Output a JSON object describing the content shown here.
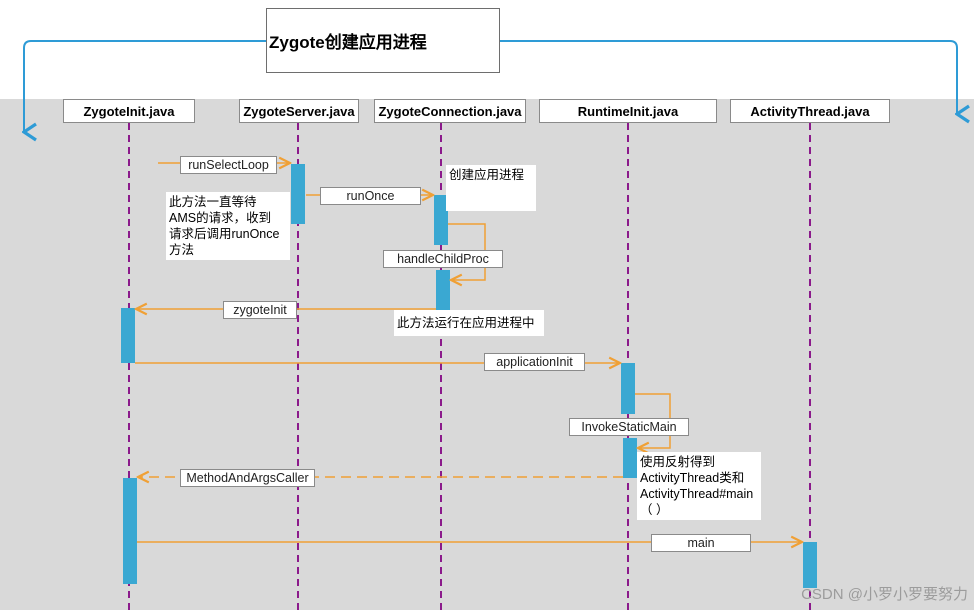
{
  "title": "Zygote创建应用进程",
  "lifelines": [
    {
      "id": "zygoteinit",
      "label": "ZygoteInit.java"
    },
    {
      "id": "zygoteserver",
      "label": "ZygoteServer.java"
    },
    {
      "id": "zygoteconnection",
      "label": "ZygoteConnection.java"
    },
    {
      "id": "runtimeinit",
      "label": "RuntimeInit.java"
    },
    {
      "id": "activitythread",
      "label": "ActivityThread.java"
    }
  ],
  "messages": [
    {
      "id": "runselectloop",
      "label": "runSelectLoop"
    },
    {
      "id": "runonce",
      "label": "runOnce"
    },
    {
      "id": "handlechildproc",
      "label": "handleChildProc"
    },
    {
      "id": "zygoteinit-call",
      "label": "zygoteInit"
    },
    {
      "id": "applicationinit",
      "label": "applicationInit"
    },
    {
      "id": "invokestaticmain",
      "label": "InvokeStaticMain"
    },
    {
      "id": "methodandargscaller",
      "label": "MethodAndArgsCaller"
    },
    {
      "id": "main",
      "label": "main"
    }
  ],
  "notes": {
    "wait_ams": "此方法一直等待\nAMS的请求，收到\n请求后调用runOnce\n方法",
    "create_process": "创建应用进程",
    "runs_in_app": "此方法运行在应用进程中",
    "reflection": "使用反射得到\nActivityThread类和\nActivityThread#main\n（ ）"
  },
  "watermark": "CSDN @小罗小罗要努力",
  "colors": {
    "lifeline": "#8b1a8b",
    "activation": "#3aa8d2",
    "arrow": "#f0a035",
    "bracket": "#2e9bd6",
    "canvas": "#d9d9d9"
  }
}
